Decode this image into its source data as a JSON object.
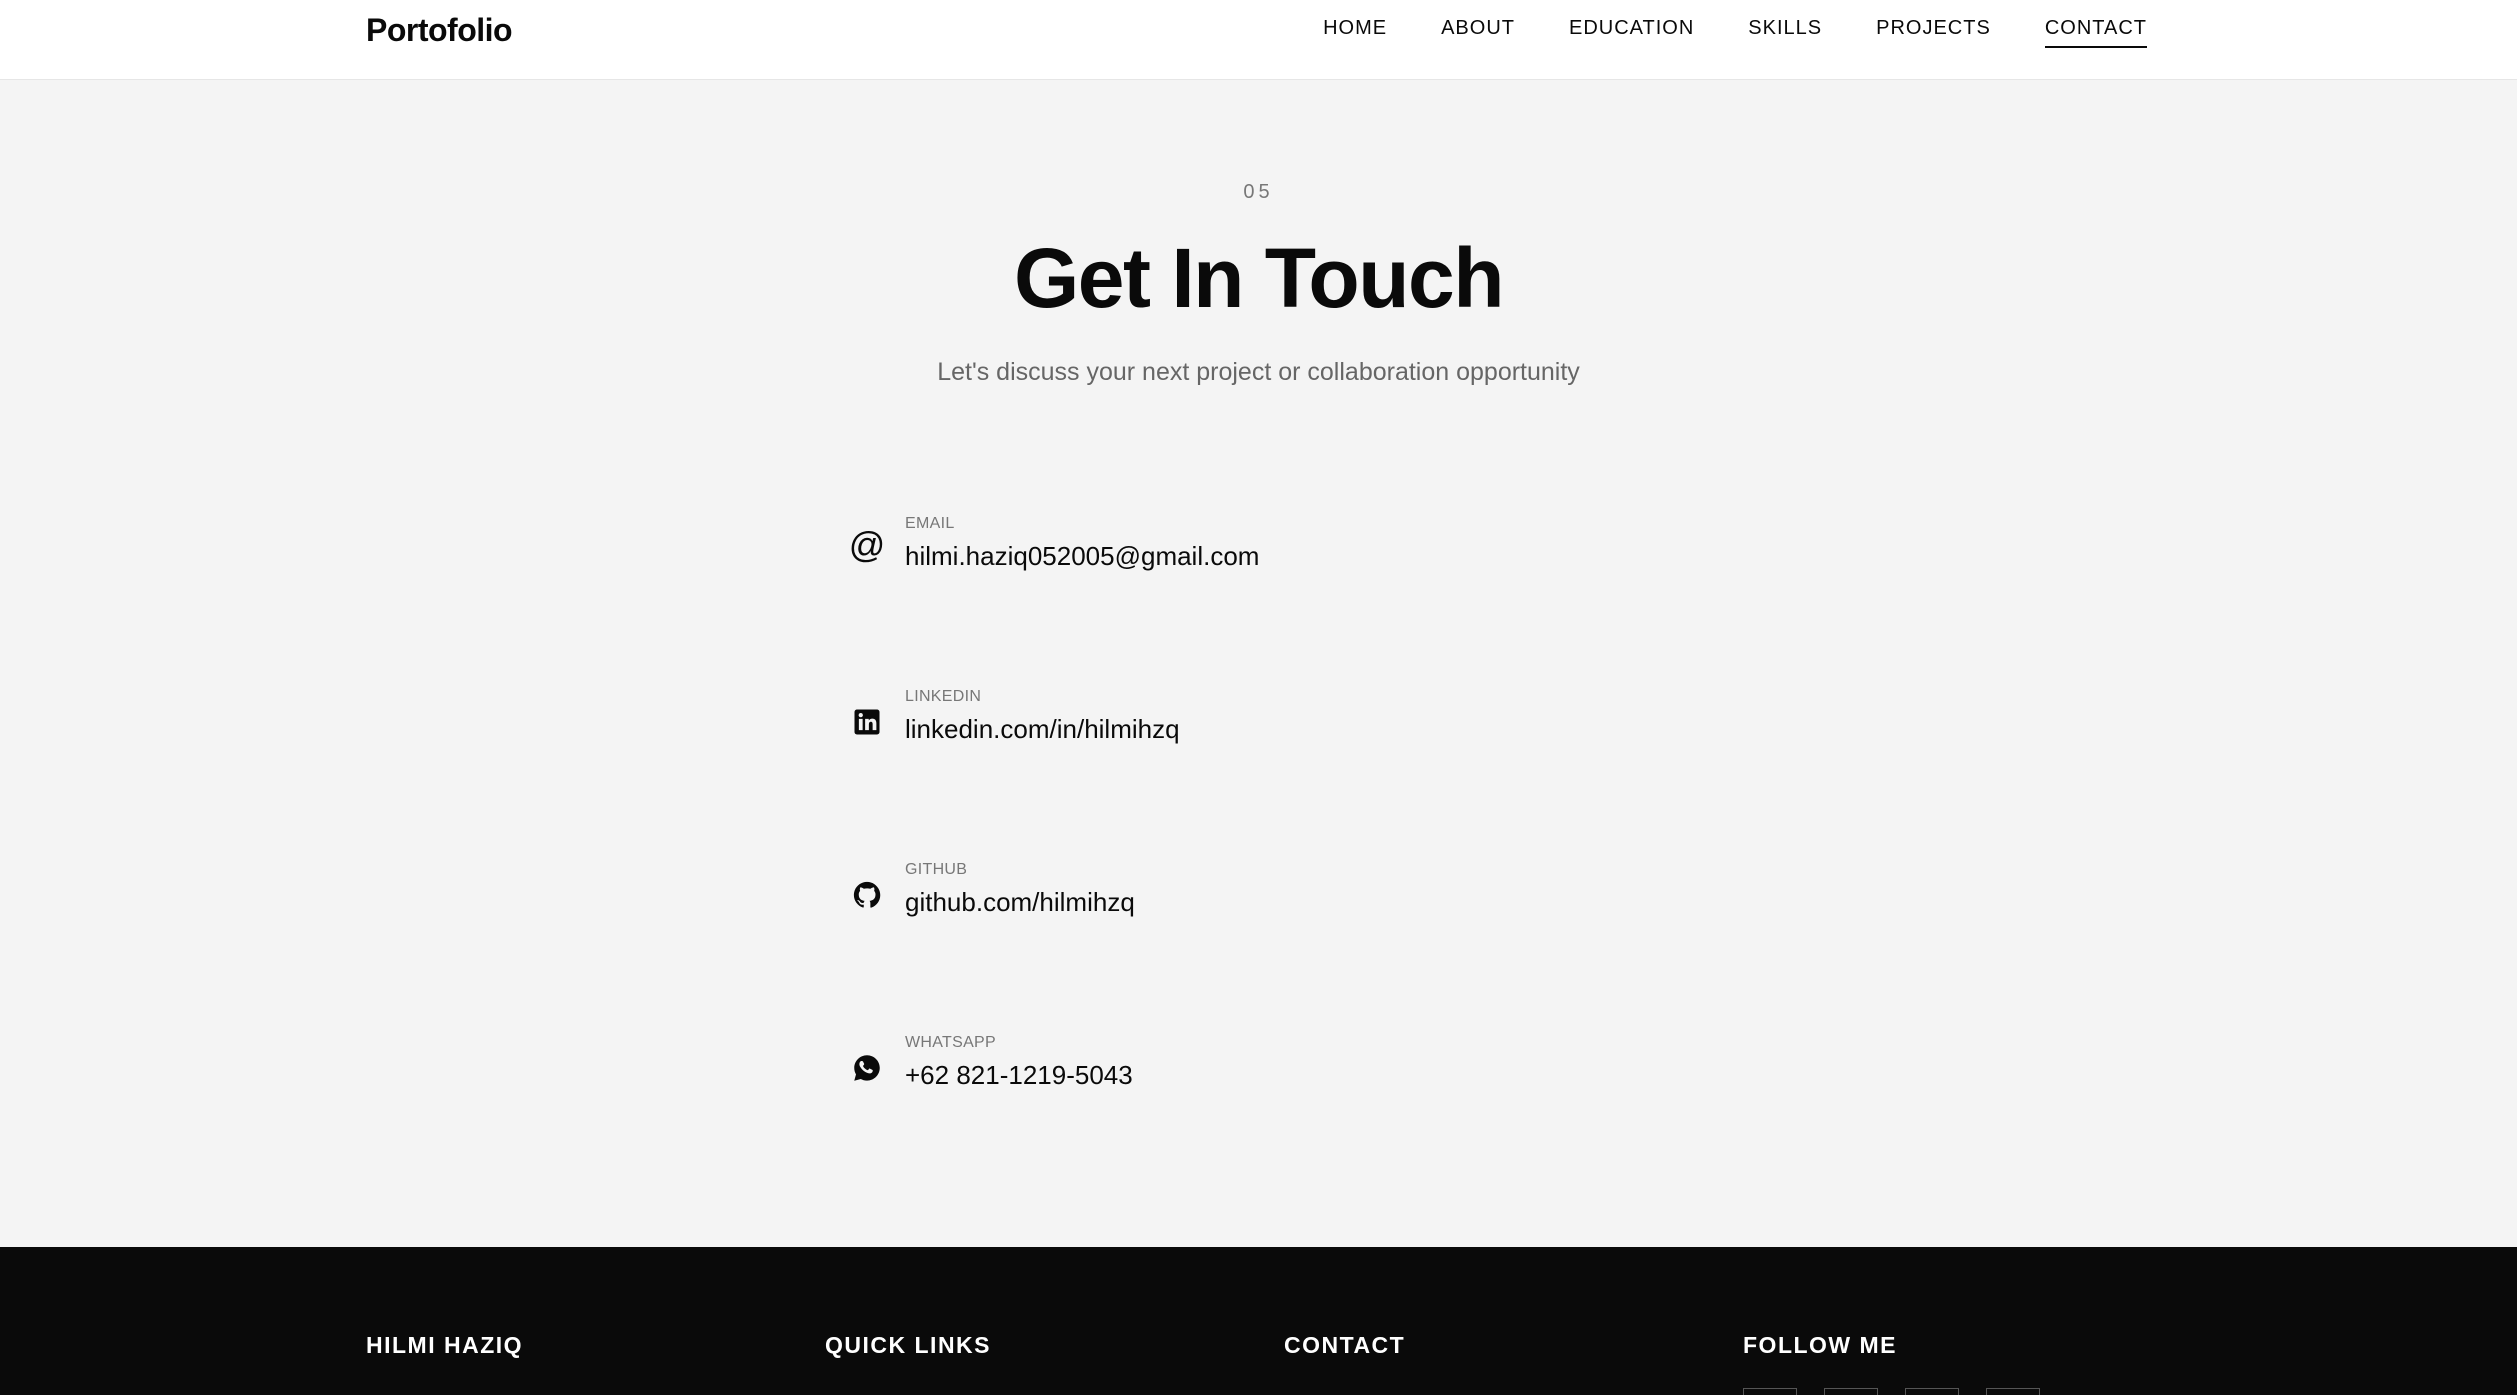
{
  "navbar": {
    "brand": "Portofolio",
    "links": [
      {
        "label": "HOME",
        "active": false
      },
      {
        "label": "ABOUT",
        "active": false
      },
      {
        "label": "EDUCATION",
        "active": false
      },
      {
        "label": "SKILLS",
        "active": false
      },
      {
        "label": "PROJECTS",
        "active": false
      },
      {
        "label": "CONTACT",
        "active": true
      }
    ]
  },
  "contact": {
    "number": "05",
    "title": "Get In Touch",
    "subtitle": "Let's discuss your next project or collaboration opportunity",
    "items": [
      {
        "icon": "at-icon",
        "label": "EMAIL",
        "value": "hilmi.haziq052005@gmail.com"
      },
      {
        "icon": "linkedin-icon",
        "label": "LINKEDIN",
        "value": "linkedin.com/in/hilmihzq"
      },
      {
        "icon": "github-icon",
        "label": "GITHUB",
        "value": "github.com/hilmihzq"
      },
      {
        "icon": "whatsapp-icon",
        "label": "WHATSAPP",
        "value": "+62 821-1219-5043"
      }
    ]
  },
  "footer": {
    "columns": [
      "HILMI HAZIQ",
      "QUICK LINKS",
      "CONTACT",
      "FOLLOW ME"
    ],
    "social_icons": [
      "social-icon-1",
      "social-icon-2",
      "social-icon-3",
      "social-icon-4"
    ]
  },
  "colors": {
    "page_background": "#f4f4f4",
    "navbar_background": "#ffffff",
    "footer_background": "#0a0a0a",
    "text_primary": "#0a0a0a",
    "text_muted": "#777777"
  }
}
